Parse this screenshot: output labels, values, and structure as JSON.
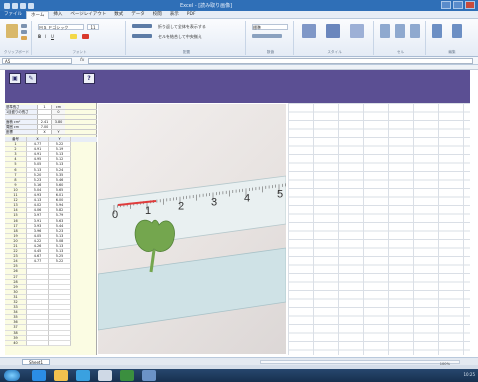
{
  "window": {
    "title": "Excel - [読み取り画像]"
  },
  "ribbon_tabs": [
    "ファイル",
    "ホーム",
    "挿入",
    "ページレイアウト",
    "数式",
    "データ",
    "校閲",
    "表示",
    "PDF"
  ],
  "ribbon": {
    "font_name": "ＭＳ Ｐゴシック",
    "font_size": "11",
    "wrap_label": "折り返して全体を表示する",
    "merge_label": "セルを結合して中央揃え",
    "number_format": "標準",
    "groups": [
      "クリップボード",
      "フォント",
      "配置",
      "数値",
      "スタイル",
      "セル",
      "編集"
    ]
  },
  "formula_bar": {
    "name_box": "A5",
    "fx": "fx",
    "value": ""
  },
  "toolbar": {
    "help_label": "?"
  },
  "info_rows": [
    {
      "key": "基準長さ",
      "value": "1",
      "unit": "cm"
    },
    {
      "key": "1目盛りの長さ",
      "value": "",
      "unit": "0"
    },
    {
      "key": "",
      "value": "",
      "unit": ""
    },
    {
      "key": "面積 cm²",
      "value": "2.41",
      "unit": "3.80"
    },
    {
      "key": "周囲 cm",
      "value": "7.00",
      "unit": ""
    },
    {
      "key": "座標",
      "value": "X",
      "unit": "Y"
    }
  ],
  "data_table": {
    "headers": [
      "番号",
      "X",
      "Y"
    ],
    "rows": [
      [
        "1",
        "4.77",
        "5.22"
      ],
      [
        "2",
        "4.91",
        "5.19"
      ],
      [
        "3",
        "4.91",
        "5.13"
      ],
      [
        "4",
        "4.95",
        "5.12"
      ],
      [
        "5",
        "5.05",
        "5.13"
      ],
      [
        "6",
        "5.13",
        "5.24"
      ],
      [
        "7",
        "5.20",
        "5.35"
      ],
      [
        "8",
        "5.23",
        "5.46"
      ],
      [
        "9",
        "5.16",
        "5.60"
      ],
      [
        "10",
        "5.04",
        "5.65"
      ],
      [
        "11",
        "4.93",
        "6.01"
      ],
      [
        "12",
        "4.13",
        "6.00"
      ],
      [
        "13",
        "4.02",
        "5.94"
      ],
      [
        "14",
        "4.06",
        "5.82"
      ],
      [
        "15",
        "3.97",
        "5.79"
      ],
      [
        "16",
        "3.91",
        "5.63"
      ],
      [
        "17",
        "3.93",
        "5.44"
      ],
      [
        "18",
        "3.96",
        "5.23"
      ],
      [
        "19",
        "4.05",
        "5.13"
      ],
      [
        "20",
        "4.22",
        "5.08"
      ],
      [
        "21",
        "4.26",
        "5.13"
      ],
      [
        "22",
        "4.45",
        "5.13"
      ],
      [
        "23",
        "4.67",
        "5.25"
      ],
      [
        "24",
        "4.77",
        "5.22"
      ],
      [
        "25",
        "",
        ""
      ],
      [
        "26",
        "",
        ""
      ],
      [
        "27",
        "",
        ""
      ],
      [
        "28",
        "",
        ""
      ],
      [
        "29",
        "",
        ""
      ],
      [
        "30",
        "",
        ""
      ],
      [
        "31",
        "",
        ""
      ],
      [
        "32",
        "",
        ""
      ],
      [
        "33",
        "",
        ""
      ],
      [
        "34",
        "",
        ""
      ],
      [
        "35",
        "",
        ""
      ],
      [
        "36",
        "",
        ""
      ],
      [
        "37",
        "",
        ""
      ],
      [
        "38",
        "",
        ""
      ],
      [
        "39",
        "",
        ""
      ],
      [
        "40",
        "",
        ""
      ]
    ]
  },
  "ruler": {
    "labels": [
      "0",
      "1",
      "2",
      "3",
      "4",
      "5"
    ]
  },
  "sheet_tab": "Sheet1",
  "status": {
    "zoom": "100%"
  },
  "taskbar": {
    "clock": "10:25"
  },
  "colors": {
    "title_bar": "#2f6fb7",
    "purple_band": "#5b4f93",
    "data_panel": "#fbfce3",
    "leaf": "#74a64e"
  }
}
